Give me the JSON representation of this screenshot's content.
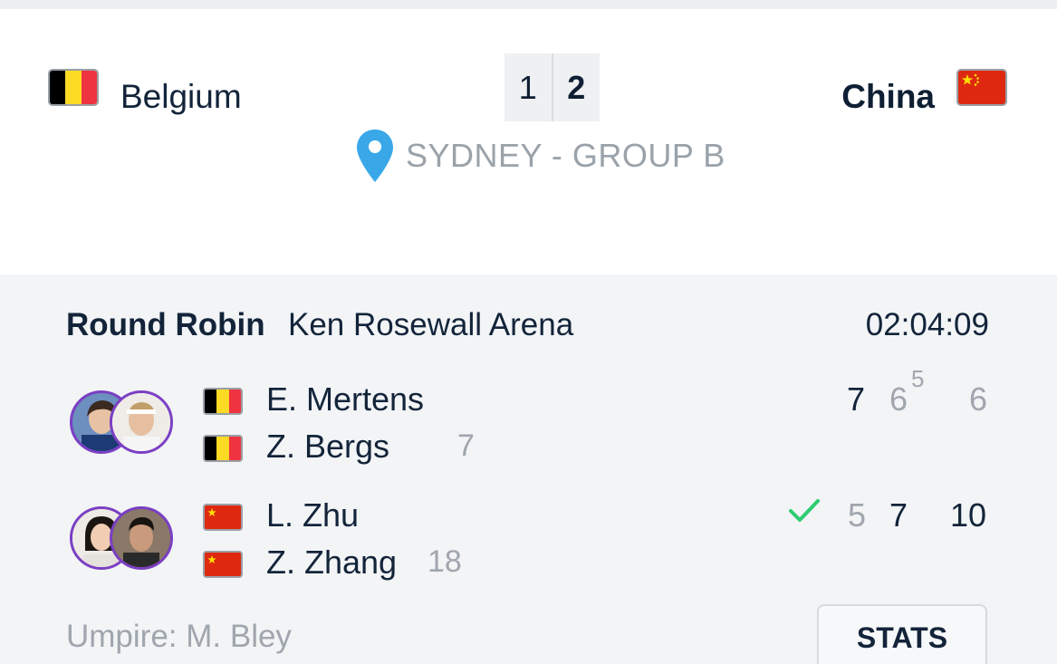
{
  "header": {
    "home_team": {
      "name": "Belgium",
      "flag": "belgium-flag",
      "score": "1"
    },
    "away_team": {
      "name": "China",
      "flag": "china-flag",
      "score": "2"
    },
    "location": "SYDNEY - GROUP B"
  },
  "match": {
    "round": "Round Robin",
    "venue": "Ken Rosewall Arena",
    "duration": "02:04:09",
    "team1": {
      "players": [
        {
          "name": "E. Mertens",
          "flag": "belgium-flag"
        },
        {
          "name": "Z. Bergs",
          "flag": "belgium-flag",
          "seed": "7"
        }
      ],
      "sets": [
        "7",
        "6",
        "6"
      ],
      "tiebreak": "5"
    },
    "team2": {
      "players": [
        {
          "name": "L. Zhu",
          "flag": "china-flag"
        },
        {
          "name": "Z. Zhang",
          "flag": "china-flag",
          "seed": "18"
        }
      ],
      "sets": [
        "5",
        "7",
        "10"
      ],
      "winner_icon": "checkmark-icon"
    },
    "umpire": "Umpire: M. Bley",
    "stats_label": "STATS"
  },
  "colors": {
    "accent_pin": "#3aa8e8",
    "avatar_ring": "#7b3fc4",
    "win_check": "#2ecc71",
    "muted_text": "#a0a6ad",
    "primary_text": "#13243a"
  }
}
